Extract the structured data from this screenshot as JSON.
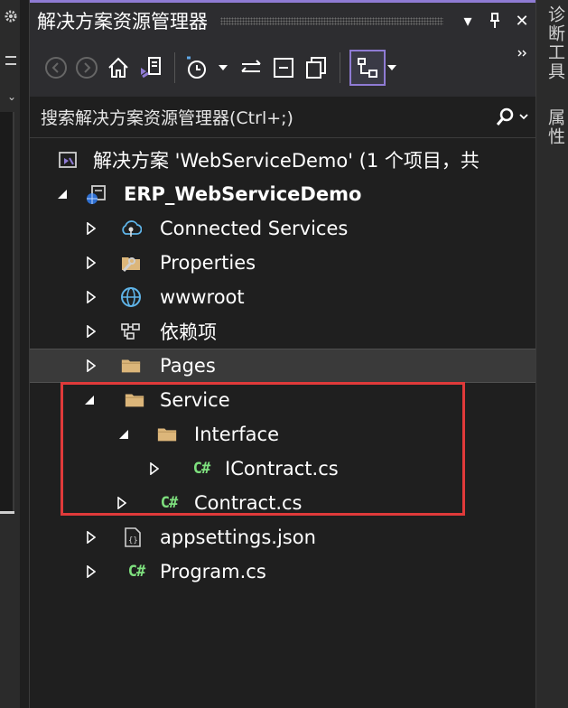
{
  "panel": {
    "title": "解决方案资源管理器",
    "search_placeholder": "搜索解决方案资源管理器(Ctrl+;)"
  },
  "tree": [
    {
      "label": "解决方案 'WebServiceDemo' (1 个项目，共",
      "icon": "solution-icon",
      "arrow": "none"
    },
    {
      "label": "ERP_WebServiceDemo",
      "icon": "web-project-icon",
      "arrow": "expanded",
      "bold": true
    },
    {
      "label": "Connected Services",
      "icon": "connected-services-icon",
      "arrow": "collapsed"
    },
    {
      "label": "Properties",
      "icon": "properties-icon",
      "arrow": "collapsed"
    },
    {
      "label": "wwwroot",
      "icon": "globe-icon",
      "arrow": "collapsed"
    },
    {
      "label": "依赖项",
      "icon": "dependencies-icon",
      "arrow": "collapsed"
    },
    {
      "label": "Pages",
      "icon": "folder-icon",
      "arrow": "collapsed",
      "hover": true
    },
    {
      "label": "Service",
      "icon": "folder-icon",
      "arrow": "expanded"
    },
    {
      "label": "Interface",
      "icon": "folder-icon",
      "arrow": "expanded"
    },
    {
      "label": "IContract.cs",
      "icon": "csharp-file-icon",
      "arrow": "collapsed"
    },
    {
      "label": "Contract.cs",
      "icon": "csharp-file-icon",
      "arrow": "collapsed"
    },
    {
      "label": "appsettings.json",
      "icon": "json-file-icon",
      "arrow": "collapsed"
    },
    {
      "label": "Program.cs",
      "icon": "csharp-file-icon",
      "arrow": "collapsed"
    }
  ],
  "right_strip": {
    "tab1": "诊断工具",
    "tab2": "属性"
  },
  "colors": {
    "accent": "#8f7bd4",
    "highlight_box": "#e03a3a",
    "csharp_icon": "#7ee07e",
    "folder": "#dcb67a"
  }
}
